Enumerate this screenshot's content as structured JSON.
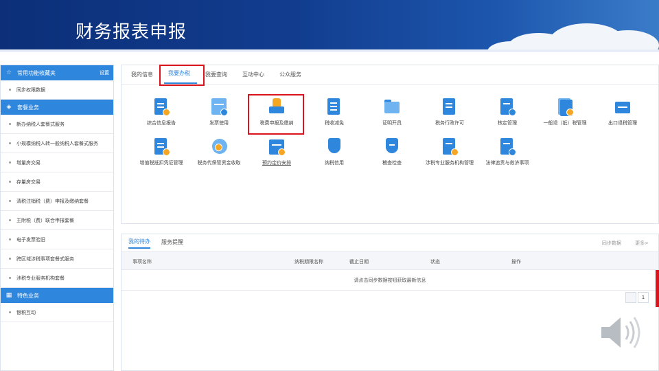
{
  "banner": {
    "title": "财务报表申报"
  },
  "sidebar": {
    "sections": [
      {
        "title": "常用功能收藏夹",
        "action": "设置",
        "items": [
          "同步权限数据"
        ]
      },
      {
        "title": "套餐业务",
        "items": [
          "新办纳税人套餐式服务",
          "小规模纳税人转一般纳税人套餐式服务",
          "增量房交易",
          "存量房交易",
          "清税注销税（费）申报及缴纳套餐",
          "主附税（费）联合申报套餐",
          "电子发票验旧",
          "跨区域涉税事项套餐式服务",
          "涉税专业服务机构套餐"
        ]
      },
      {
        "title": "特色业务",
        "items": [
          "银税互动"
        ]
      }
    ]
  },
  "main": {
    "tabs": [
      "我的信息",
      "我要办税",
      "我要查询",
      "互动中心",
      "公众服务"
    ],
    "active_tab": 1,
    "functions": [
      "综合信息报告",
      "发票使用",
      "税费申报及缴纳",
      "税收减免",
      "证明开具",
      "税务行政许可",
      "核定管理",
      "一般退（抵）税管理",
      "出口退税管理",
      "增值税抵扣凭证管理",
      "税务代保管资金收取",
      "预约定价安排",
      "纳税信用",
      "稽查检查",
      "涉税专业服务机构管理",
      "法律追责与救济事项"
    ]
  },
  "todo": {
    "tabs": [
      "我的待办",
      "服务提醒"
    ],
    "links": [
      "同步数据",
      "更多>"
    ],
    "columns": [
      "事项名称",
      "纳税期限名称",
      "截止日期",
      "状态",
      "操作"
    ],
    "empty_text": "请点击同步数据按钮获取最新信息",
    "page": "1"
  },
  "colors": {
    "primary": "#2f86dd",
    "banner": "#123d8f",
    "highlight": "#d9141c"
  },
  "icons": {
    "speaker": "speaker-icon"
  }
}
